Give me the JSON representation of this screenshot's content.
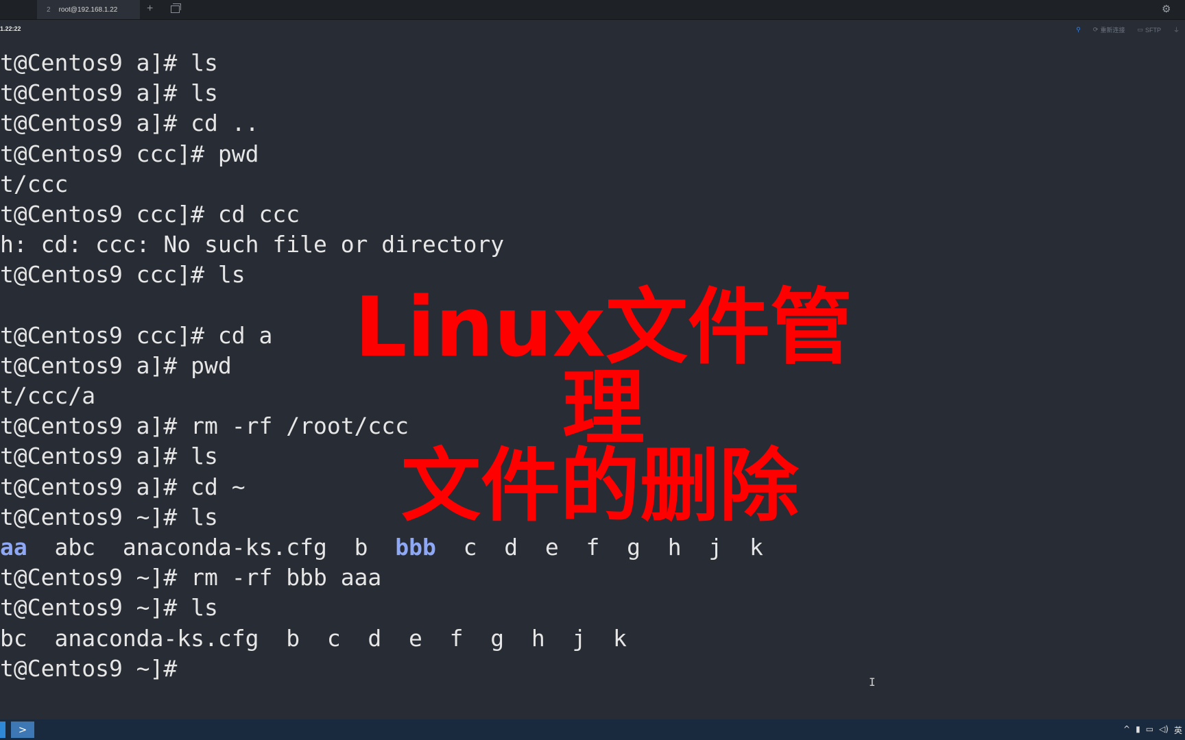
{
  "tabbar": {
    "tab_number": "2",
    "tab_title": "root@192.168.1.22",
    "new_tab_symbol": "+"
  },
  "infobar": {
    "host_fragment": "1.22:22",
    "tools": [
      "重新连接",
      "SFTP"
    ]
  },
  "terminal": {
    "lines": [
      {
        "text": "t@Centos9 a]# ls"
      },
      {
        "text": "t@Centos9 a]# ls"
      },
      {
        "text": "t@Centos9 a]# cd .."
      },
      {
        "text": "t@Centos9 ccc]# pwd"
      },
      {
        "text": "t/ccc"
      },
      {
        "text": "t@Centos9 ccc]# cd ccc"
      },
      {
        "text": "h: cd: ccc: No such file or directory"
      },
      {
        "text": "t@Centos9 ccc]# ls"
      },
      {
        "text": ""
      },
      {
        "text": "t@Centos9 ccc]# cd a"
      },
      {
        "text": "t@Centos9 a]# pwd"
      },
      {
        "text": "t/ccc/a"
      },
      {
        "text": "t@Centos9 a]# rm -rf /root/ccc"
      },
      {
        "text": "t@Centos9 a]# ls"
      },
      {
        "text": "t@Centos9 a]# cd ~"
      },
      {
        "text": "t@Centos9 ~]# ls"
      },
      {
        "ls_items": [
          {
            "name": "aa",
            "dir": true
          },
          {
            "name": "abc",
            "dir": false
          },
          {
            "name": "anaconda-ks.cfg",
            "dir": false
          },
          {
            "name": "b",
            "dir": false
          },
          {
            "name": "bbb",
            "dir": true
          },
          {
            "name": "c",
            "dir": false
          },
          {
            "name": "d",
            "dir": false
          },
          {
            "name": "e",
            "dir": false
          },
          {
            "name": "f",
            "dir": false
          },
          {
            "name": "g",
            "dir": false
          },
          {
            "name": "h",
            "dir": false
          },
          {
            "name": "j",
            "dir": false
          },
          {
            "name": "k",
            "dir": false
          }
        ]
      },
      {
        "text": "t@Centos9 ~]# rm -rf bbb aaa"
      },
      {
        "text": "t@Centos9 ~]# ls"
      },
      {
        "text": "bc  anaconda-ks.cfg  b  c  d  e  f  g  h  j  k"
      },
      {
        "text": "t@Centos9 ~]#"
      }
    ],
    "colors": {
      "background": "#282c34",
      "text": "#e6e6e6",
      "directory": "#8fa8f5"
    }
  },
  "overlay": {
    "line1": "Linux文件管理",
    "line2": "文件的删除",
    "color": "#ff0000"
  },
  "taskbar": {
    "terminal_app_icon": "terminal-icon",
    "tray_lang": "英"
  }
}
